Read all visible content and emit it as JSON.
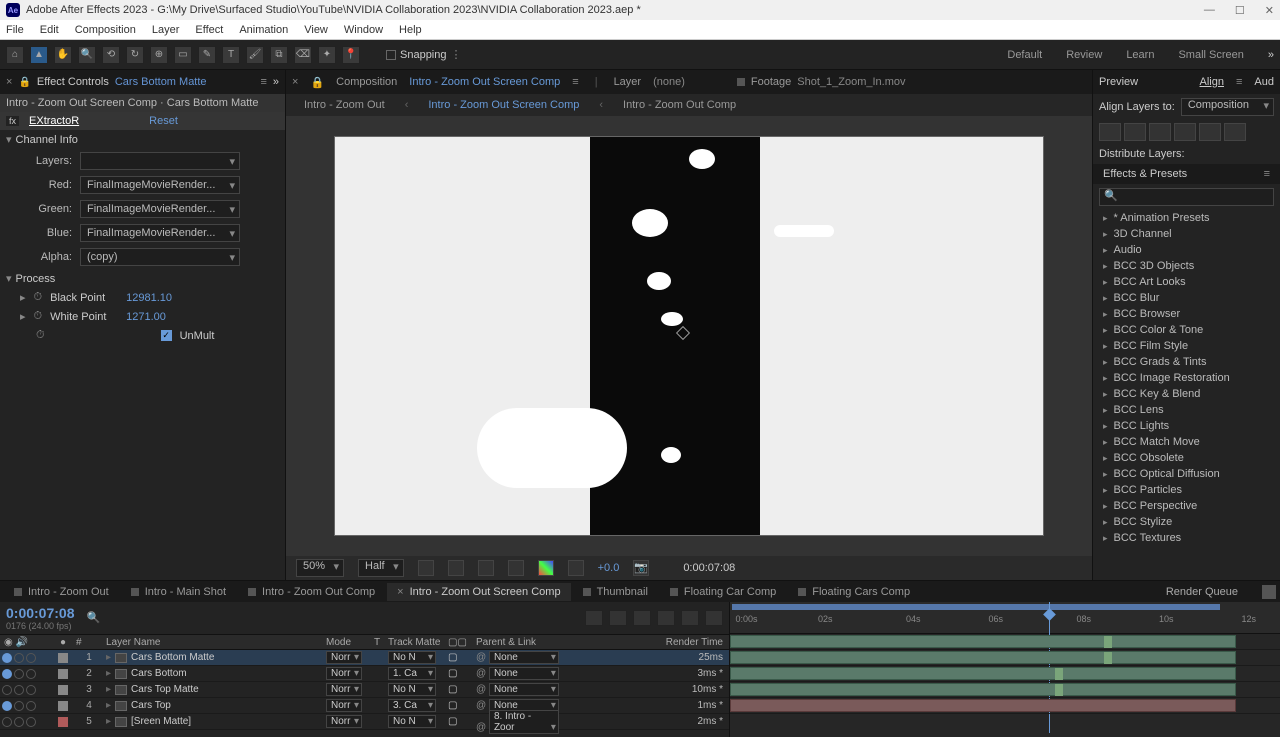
{
  "title_bar": {
    "text": "Adobe After Effects 2023 - G:\\My Drive\\Surfaced Studio\\YouTube\\NVIDIA Collaboration 2023\\NVIDIA Collaboration 2023.aep *"
  },
  "menu": [
    "File",
    "Edit",
    "Composition",
    "Layer",
    "Effect",
    "Animation",
    "View",
    "Window",
    "Help"
  ],
  "toolbar": {
    "snapping": "Snapping",
    "workspaces": [
      "Default",
      "Review",
      "Learn",
      "Small Screen"
    ]
  },
  "effect_controls": {
    "panel_title": "Effect Controls",
    "layer_name": "Cars Bottom Matte",
    "breadcrumb": "Intro - Zoom Out Screen Comp · Cars Bottom Matte",
    "effect_name": "EXtractoR",
    "reset": "Reset",
    "channel_info": "Channel Info",
    "props": {
      "layers_label": "Layers:",
      "red_label": "Red:",
      "red_val": "FinalImageMovieRender...",
      "green_label": "Green:",
      "green_val": "FinalImageMovieRender...",
      "blue_label": "Blue:",
      "blue_val": "FinalImageMovieRender...",
      "alpha_label": "Alpha:",
      "alpha_val": "(copy)"
    },
    "process": {
      "header": "Process",
      "black_point_label": "Black Point",
      "black_point_val": "12981.10",
      "white_point_label": "White Point",
      "white_point_val": "1271.00",
      "unmult_label": "UnMult"
    }
  },
  "composition": {
    "panel_title": "Composition",
    "comp_name": "Intro - Zoom Out Screen Comp",
    "layer_lbl": "Layer",
    "layer_val": "(none)",
    "footage_lbl": "Footage",
    "footage_val": "Shot_1_Zoom_In.mov",
    "nav": [
      "Intro - Zoom Out",
      "Intro - Zoom Out Screen Comp",
      "Intro - Zoom Out Comp"
    ],
    "nav_active": 1,
    "zoom": "50%",
    "res": "Half",
    "exposure": "+0.0",
    "timecode": "0:00:07:08"
  },
  "right": {
    "preview": "Preview",
    "align": "Align",
    "aud": "Aud",
    "align_to_label": "Align Layers to:",
    "align_to_val": "Composition",
    "distribute": "Distribute Layers:",
    "effects_presets": "Effects & Presets",
    "list": [
      "* Animation Presets",
      "3D Channel",
      "Audio",
      "BCC 3D Objects",
      "BCC Art Looks",
      "BCC Blur",
      "BCC Browser",
      "BCC Color & Tone",
      "BCC Film Style",
      "BCC Grads & Tints",
      "BCC Image Restoration",
      "BCC Key & Blend",
      "BCC Lens",
      "BCC Lights",
      "BCC Match Move",
      "BCC Obsolete",
      "BCC Optical Diffusion",
      "BCC Particles",
      "BCC Perspective",
      "BCC Stylize",
      "BCC Textures"
    ]
  },
  "timeline": {
    "tabs": [
      "Intro - Zoom Out",
      "Intro - Main Shot",
      "Intro - Zoom Out Comp",
      "Intro - Zoom Out Screen Comp",
      "Thumbnail",
      "Floating Car Comp",
      "Floating Cars Comp"
    ],
    "active_tab": 3,
    "render_queue": "Render Queue",
    "timecode": "0:00:07:08",
    "fps": "0176 (24.00 fps)",
    "headers": {
      "num": "#",
      "layer_name": "Layer Name",
      "mode": "Mode",
      "t": "T",
      "track_matte": "Track Matte",
      "parent": "Parent & Link",
      "render_time": "Render Time"
    },
    "ruler": [
      "0:00s",
      "02s",
      "04s",
      "06s",
      "08s",
      "10s",
      "12s"
    ],
    "layers": [
      {
        "num": "1",
        "name": "Cars Bottom Matte",
        "mode": "Norr",
        "matte": "No N",
        "parent": "None",
        "rt": "25ms",
        "sel": true,
        "swatch": "#888",
        "eye": true
      },
      {
        "num": "2",
        "name": "Cars Bottom",
        "mode": "Norr",
        "matte": "1. Ca",
        "parent": "None",
        "rt": "3ms *",
        "sel": false,
        "swatch": "#888",
        "eye": true
      },
      {
        "num": "3",
        "name": "Cars Top Matte",
        "mode": "Norr",
        "matte": "No N",
        "parent": "None",
        "rt": "10ms *",
        "sel": false,
        "swatch": "#888",
        "eye": false
      },
      {
        "num": "4",
        "name": "Cars Top",
        "mode": "Norr",
        "matte": "3. Ca",
        "parent": "None",
        "rt": "1ms *",
        "sel": false,
        "swatch": "#888",
        "eye": true
      },
      {
        "num": "5",
        "name": "[Sreen Matte]",
        "mode": "Norr",
        "matte": "No N",
        "parent": "8. Intro - Zoor",
        "rt": "2ms *",
        "sel": false,
        "swatch": "#b05a5a",
        "eye": false
      }
    ]
  }
}
